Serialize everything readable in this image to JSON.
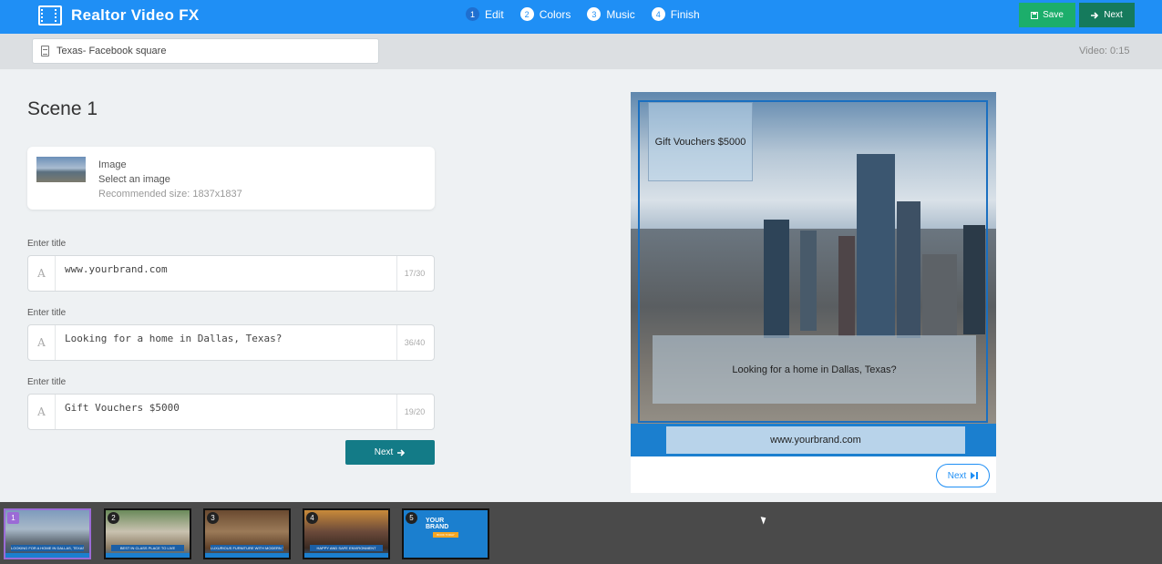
{
  "app": {
    "title": "Realtor Video FX"
  },
  "steps": [
    {
      "num": "1",
      "label": "Edit"
    },
    {
      "num": "2",
      "label": "Colors"
    },
    {
      "num": "3",
      "label": "Music"
    },
    {
      "num": "4",
      "label": "Finish"
    }
  ],
  "toolbar": {
    "save_label": "Save",
    "next_label": "Next"
  },
  "project": {
    "name": "Texas- Facebook square",
    "video_length": "Video: 0:15"
  },
  "scene": {
    "title": "Scene 1",
    "image": {
      "label": "Image",
      "action": "Select an image",
      "hint": "Recommended size: 1837x1837"
    },
    "fields": [
      {
        "label": "Enter title",
        "value": "www.yourbrand.com",
        "count": "17/30"
      },
      {
        "label": "Enter title",
        "value": "Looking for a home in Dallas, Texas?",
        "count": "36/40"
      },
      {
        "label": "Enter title",
        "value": "Gift Vouchers $5000",
        "count": "19/20"
      }
    ],
    "next_label": "Next"
  },
  "preview": {
    "top_text": "Gift Vouchers $5000",
    "middle_text": "Looking for a home in Dallas, Texas?",
    "brand_text": "www.yourbrand.com",
    "next_label": "Next"
  },
  "timeline": {
    "scenes": [
      {
        "num": "1",
        "caption": "LOOKING FOR A HOME IN DALLAS, TEXAS?"
      },
      {
        "num": "2",
        "caption": "BEST IN CLASS PLACE TO LIVE"
      },
      {
        "num": "3",
        "caption": "LUXURIOUS FURNITURE WITH MODERN TECHNOLOGY"
      },
      {
        "num": "4",
        "caption": "HAPPY AND SAFE ENVIRONMENT"
      },
      {
        "num": "5",
        "brand_line1": "YOUR",
        "brand_line2": "BRAND",
        "tag": "BOOK TODAY"
      }
    ]
  },
  "colors": {
    "primary": "#1f8ff5",
    "save": "#1cae6b",
    "next_dark": "#157a5c",
    "teal": "#137b87",
    "timeline_bg": "#4a4a4a"
  },
  "icons": [
    "film-icon",
    "save-icon",
    "arrow-right-icon",
    "document-icon",
    "step-forward-icon"
  ]
}
